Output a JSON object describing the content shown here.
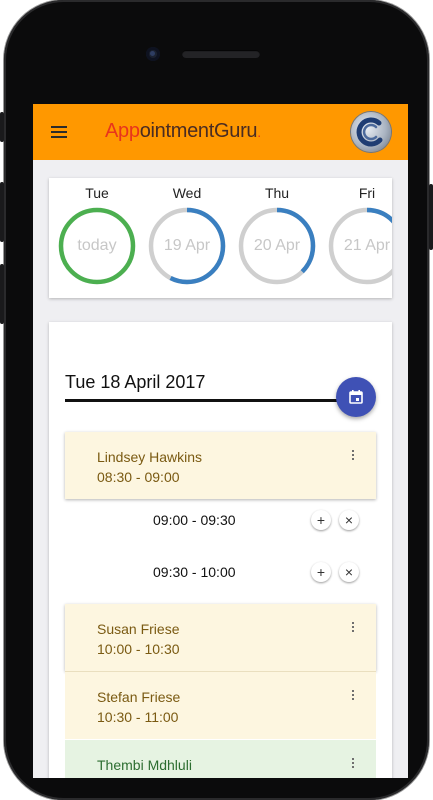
{
  "app": {
    "brand_part1": "App",
    "brand_part2": "ointmentGuru",
    "brand_part3": ".",
    "colors": {
      "toolbar": "#ff9800",
      "today_ring": "#4caf50",
      "day_ring": "#3a7fc0",
      "fab": "#3f51b5"
    }
  },
  "days": [
    {
      "name": "Tue",
      "label": "today"
    },
    {
      "name": "Wed",
      "label": "19 Apr"
    },
    {
      "name": "Thu",
      "label": "20 Apr"
    },
    {
      "name": "Fri",
      "label": "21 Apr"
    }
  ],
  "schedule": {
    "date_title": "Tue 18 April 2017",
    "appointments": [
      {
        "name": "Lindsey Hawkins",
        "time": "08:30 - 09:00"
      },
      {
        "name": "Susan Friese",
        "time": "10:00 - 10:30"
      },
      {
        "name": "Stefan Friese",
        "time": "10:30 - 11:00"
      },
      {
        "name": "Thembi Mdhluli",
        "time": ""
      }
    ],
    "free_slots": [
      {
        "time": "09:00 - 09:30",
        "add": "+",
        "remove": "×"
      },
      {
        "time": "09:30 - 10:00",
        "add": "+",
        "remove": "×"
      }
    ]
  }
}
